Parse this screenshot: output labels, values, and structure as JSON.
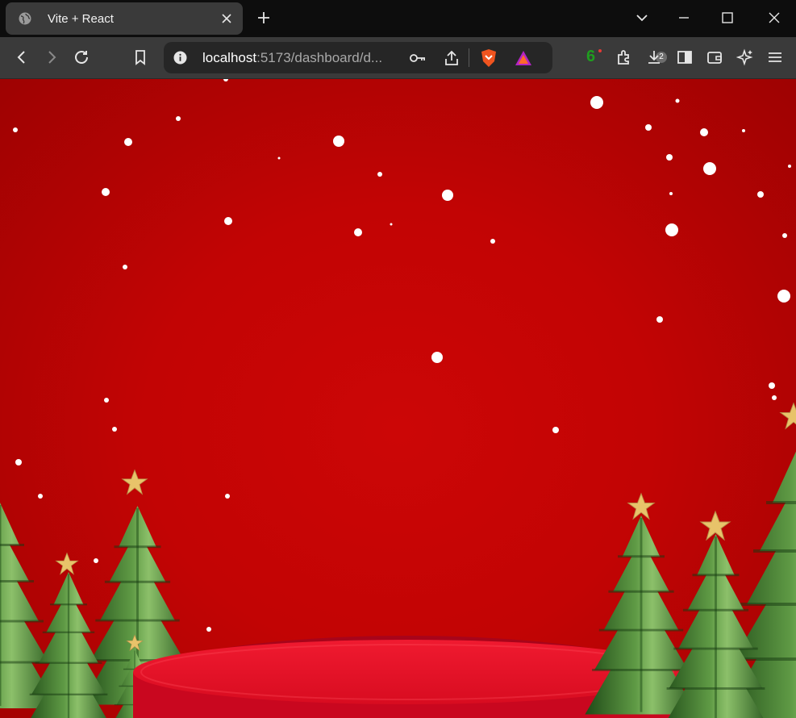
{
  "tab": {
    "title": "Vite + React",
    "icon": "globe-icon"
  },
  "address_bar": {
    "host": "localhost",
    "rest": ":5173/dashboard/d..."
  },
  "extensions": {
    "brave_shields_count": "2",
    "counter_value": "6"
  },
  "colors": {
    "background_red": "#c20404",
    "tree_green": "#3f7a2e",
    "star_gold": "#e8c36a",
    "podium_red": "#e8102a",
    "snow": "#ffffff"
  }
}
